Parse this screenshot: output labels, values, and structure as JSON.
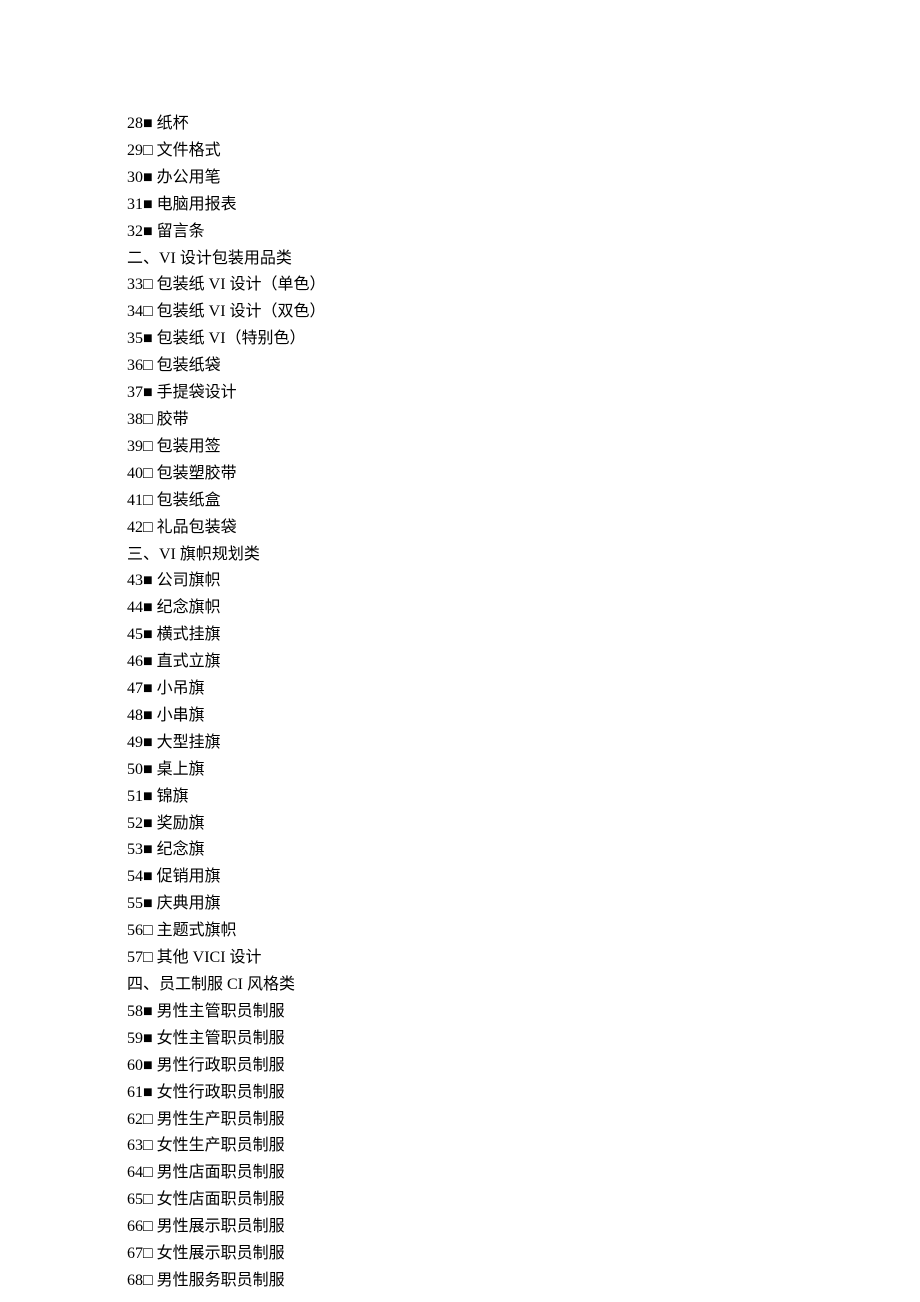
{
  "lines": [
    {
      "num": "28",
      "marker": "■",
      "label": "纸杯"
    },
    {
      "num": "29",
      "marker": "□",
      "label": "文件格式"
    },
    {
      "num": "30",
      "marker": "■",
      "label": "办公用笔"
    },
    {
      "num": "31",
      "marker": "■",
      "label": "电脑用报表"
    },
    {
      "num": "32",
      "marker": "■",
      "label": "留言条"
    },
    {
      "heading": "二、VI 设计包装用品类"
    },
    {
      "num": "33",
      "marker": "□",
      "label": "包装纸 VI 设计（单色）"
    },
    {
      "num": "34",
      "marker": "□",
      "label": "包装纸 VI 设计（双色）"
    },
    {
      "num": "35",
      "marker": "■",
      "label": "包装纸 VI（特别色）"
    },
    {
      "num": "36",
      "marker": "□",
      "label": "包装纸袋"
    },
    {
      "num": "37",
      "marker": "■",
      "label": "手提袋设计"
    },
    {
      "num": "38",
      "marker": "□",
      "label": "胶带"
    },
    {
      "num": "39",
      "marker": "□",
      "label": "包装用签"
    },
    {
      "num": "40",
      "marker": "□",
      "label": "包装塑胶带"
    },
    {
      "num": "41",
      "marker": "□",
      "label": "包装纸盒"
    },
    {
      "num": "42",
      "marker": "□",
      "label": "礼品包装袋"
    },
    {
      "heading": "三、VI 旗帜规划类"
    },
    {
      "num": "43",
      "marker": "■",
      "label": "公司旗帜"
    },
    {
      "num": "44",
      "marker": "■",
      "label": "纪念旗帜"
    },
    {
      "num": "45",
      "marker": "■",
      "label": "横式挂旗"
    },
    {
      "num": "46",
      "marker": "■",
      "label": "直式立旗"
    },
    {
      "num": "47",
      "marker": "■",
      "label": "小吊旗"
    },
    {
      "num": "48",
      "marker": "■",
      "label": "小串旗"
    },
    {
      "num": "49",
      "marker": "■",
      "label": "大型挂旗"
    },
    {
      "num": "50",
      "marker": "■",
      "label": "桌上旗"
    },
    {
      "num": "51",
      "marker": "■",
      "label": "锦旗"
    },
    {
      "num": "52",
      "marker": "■",
      "label": "奖励旗"
    },
    {
      "num": "53",
      "marker": "■",
      "label": "纪念旗"
    },
    {
      "num": "54",
      "marker": "■",
      "label": "促销用旗"
    },
    {
      "num": "55",
      "marker": "■",
      "label": "庆典用旗"
    },
    {
      "num": "56",
      "marker": "□",
      "label": "主题式旗帜"
    },
    {
      "num": "57",
      "marker": "□",
      "label": "其他 VICI 设计"
    },
    {
      "heading": "四、员工制服 CI 风格类"
    },
    {
      "num": "58",
      "marker": "■",
      "label": "男性主管职员制服"
    },
    {
      "num": "59",
      "marker": "■",
      "label": "女性主管职员制服"
    },
    {
      "num": "60",
      "marker": "■",
      "label": "男性行政职员制服"
    },
    {
      "num": "61",
      "marker": "■",
      "label": "女性行政职员制服"
    },
    {
      "num": "62",
      "marker": "□",
      "label": "男性生产职员制服"
    },
    {
      "num": "63",
      "marker": "□",
      "label": "女性生产职员制服"
    },
    {
      "num": "64",
      "marker": "□",
      "label": "男性店面职员制服"
    },
    {
      "num": "65",
      "marker": "□",
      "label": "女性店面职员制服"
    },
    {
      "num": "66",
      "marker": "□",
      "label": "男性展示职员制服"
    },
    {
      "num": "67",
      "marker": "□",
      "label": "女性展示职员制服"
    },
    {
      "num": "68",
      "marker": "□",
      "label": "男性服务职员制服"
    }
  ]
}
